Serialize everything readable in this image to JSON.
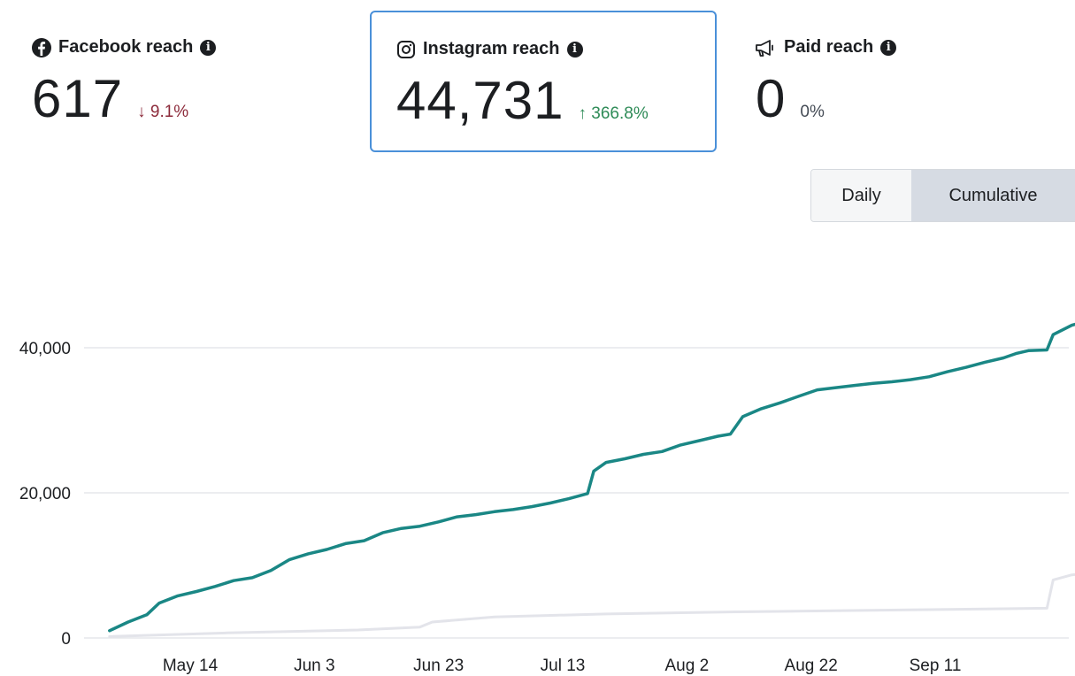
{
  "metrics": [
    {
      "label": "Facebook reach",
      "value": "617",
      "change": "9.1%",
      "direction": "down",
      "icon": "facebook-icon"
    },
    {
      "label": "Instagram reach",
      "value": "44,731",
      "change": "366.8%",
      "direction": "up",
      "icon": "instagram-icon",
      "selected": true
    },
    {
      "label": "Paid reach",
      "value": "0",
      "change": "0%",
      "direction": "none",
      "icon": "megaphone-icon"
    }
  ],
  "toggle": {
    "daily": "Daily",
    "cumulative": "Cumulative",
    "active": "cumulative"
  },
  "arrows": {
    "down": "↓",
    "up": "↑"
  },
  "colors": {
    "instagram_line": "#1a8785",
    "facebook_line": "#e3e4ea",
    "grid": "#e5e7eb",
    "selected_border": "#4a90d9",
    "down": "#8c2a3a",
    "up": "#2e8b57"
  },
  "chart_data": {
    "type": "line",
    "x_ticks": [
      "May 14",
      "Jun 3",
      "Jun 23",
      "Jul 13",
      "Aug 2",
      "Aug 22",
      "Sep 11"
    ],
    "y_ticks": [
      "0",
      "20,000",
      "40,000"
    ],
    "ylim": [
      0,
      50000
    ],
    "x_start": "2024-05-01",
    "x_end": "2024-09-28",
    "series": [
      {
        "name": "Instagram reach",
        "color": "#1a8785",
        "points": [
          [
            "2024-05-01",
            1000
          ],
          [
            "2024-05-04",
            2200
          ],
          [
            "2024-05-07",
            3200
          ],
          [
            "2024-05-09",
            4800
          ],
          [
            "2024-05-12",
            5800
          ],
          [
            "2024-05-15",
            6400
          ],
          [
            "2024-05-18",
            7100
          ],
          [
            "2024-05-21",
            7900
          ],
          [
            "2024-05-24",
            8300
          ],
          [
            "2024-05-27",
            9300
          ],
          [
            "2024-05-30",
            10800
          ],
          [
            "2024-06-02",
            11600
          ],
          [
            "2024-06-05",
            12200
          ],
          [
            "2024-06-08",
            13000
          ],
          [
            "2024-06-11",
            13400
          ],
          [
            "2024-06-14",
            14500
          ],
          [
            "2024-06-17",
            15100
          ],
          [
            "2024-06-20",
            15400
          ],
          [
            "2024-06-23",
            16000
          ],
          [
            "2024-06-26",
            16700
          ],
          [
            "2024-06-29",
            17000
          ],
          [
            "2024-07-02",
            17400
          ],
          [
            "2024-07-05",
            17700
          ],
          [
            "2024-07-08",
            18100
          ],
          [
            "2024-07-11",
            18600
          ],
          [
            "2024-07-14",
            19200
          ],
          [
            "2024-07-17",
            19900
          ],
          [
            "2024-07-18",
            23000
          ],
          [
            "2024-07-20",
            24200
          ],
          [
            "2024-07-23",
            24700
          ],
          [
            "2024-07-26",
            25300
          ],
          [
            "2024-07-29",
            25700
          ],
          [
            "2024-08-01",
            26600
          ],
          [
            "2024-08-04",
            27200
          ],
          [
            "2024-08-07",
            27800
          ],
          [
            "2024-08-09",
            28100
          ],
          [
            "2024-08-11",
            30500
          ],
          [
            "2024-08-14",
            31600
          ],
          [
            "2024-08-17",
            32400
          ],
          [
            "2024-08-20",
            33300
          ],
          [
            "2024-08-23",
            34200
          ],
          [
            "2024-08-26",
            34500
          ],
          [
            "2024-08-29",
            34800
          ],
          [
            "2024-09-01",
            35100
          ],
          [
            "2024-09-04",
            35300
          ],
          [
            "2024-09-07",
            35600
          ],
          [
            "2024-09-10",
            36000
          ],
          [
            "2024-09-13",
            36700
          ],
          [
            "2024-09-16",
            37300
          ],
          [
            "2024-09-19",
            38000
          ],
          [
            "2024-09-22",
            38600
          ],
          [
            "2024-09-24",
            39200
          ],
          [
            "2024-09-26",
            39600
          ],
          [
            "2024-09-29",
            39700
          ],
          [
            "2024-09-30",
            41800
          ],
          [
            "2024-10-03",
            43100
          ],
          [
            "2024-10-06",
            43800
          ],
          [
            "2024-10-09",
            44200
          ],
          [
            "2024-10-12",
            44731
          ]
        ]
      },
      {
        "name": "Facebook reach",
        "color": "#e3e4ea",
        "points": [
          [
            "2024-05-01",
            200
          ],
          [
            "2024-05-20",
            700
          ],
          [
            "2024-06-10",
            1100
          ],
          [
            "2024-06-20",
            1500
          ],
          [
            "2024-06-22",
            2200
          ],
          [
            "2024-07-02",
            2900
          ],
          [
            "2024-07-20",
            3300
          ],
          [
            "2024-08-10",
            3600
          ],
          [
            "2024-09-10",
            3900
          ],
          [
            "2024-09-29",
            4100
          ],
          [
            "2024-09-30",
            8000
          ],
          [
            "2024-10-03",
            8700
          ],
          [
            "2024-10-12",
            9300
          ]
        ]
      }
    ]
  }
}
